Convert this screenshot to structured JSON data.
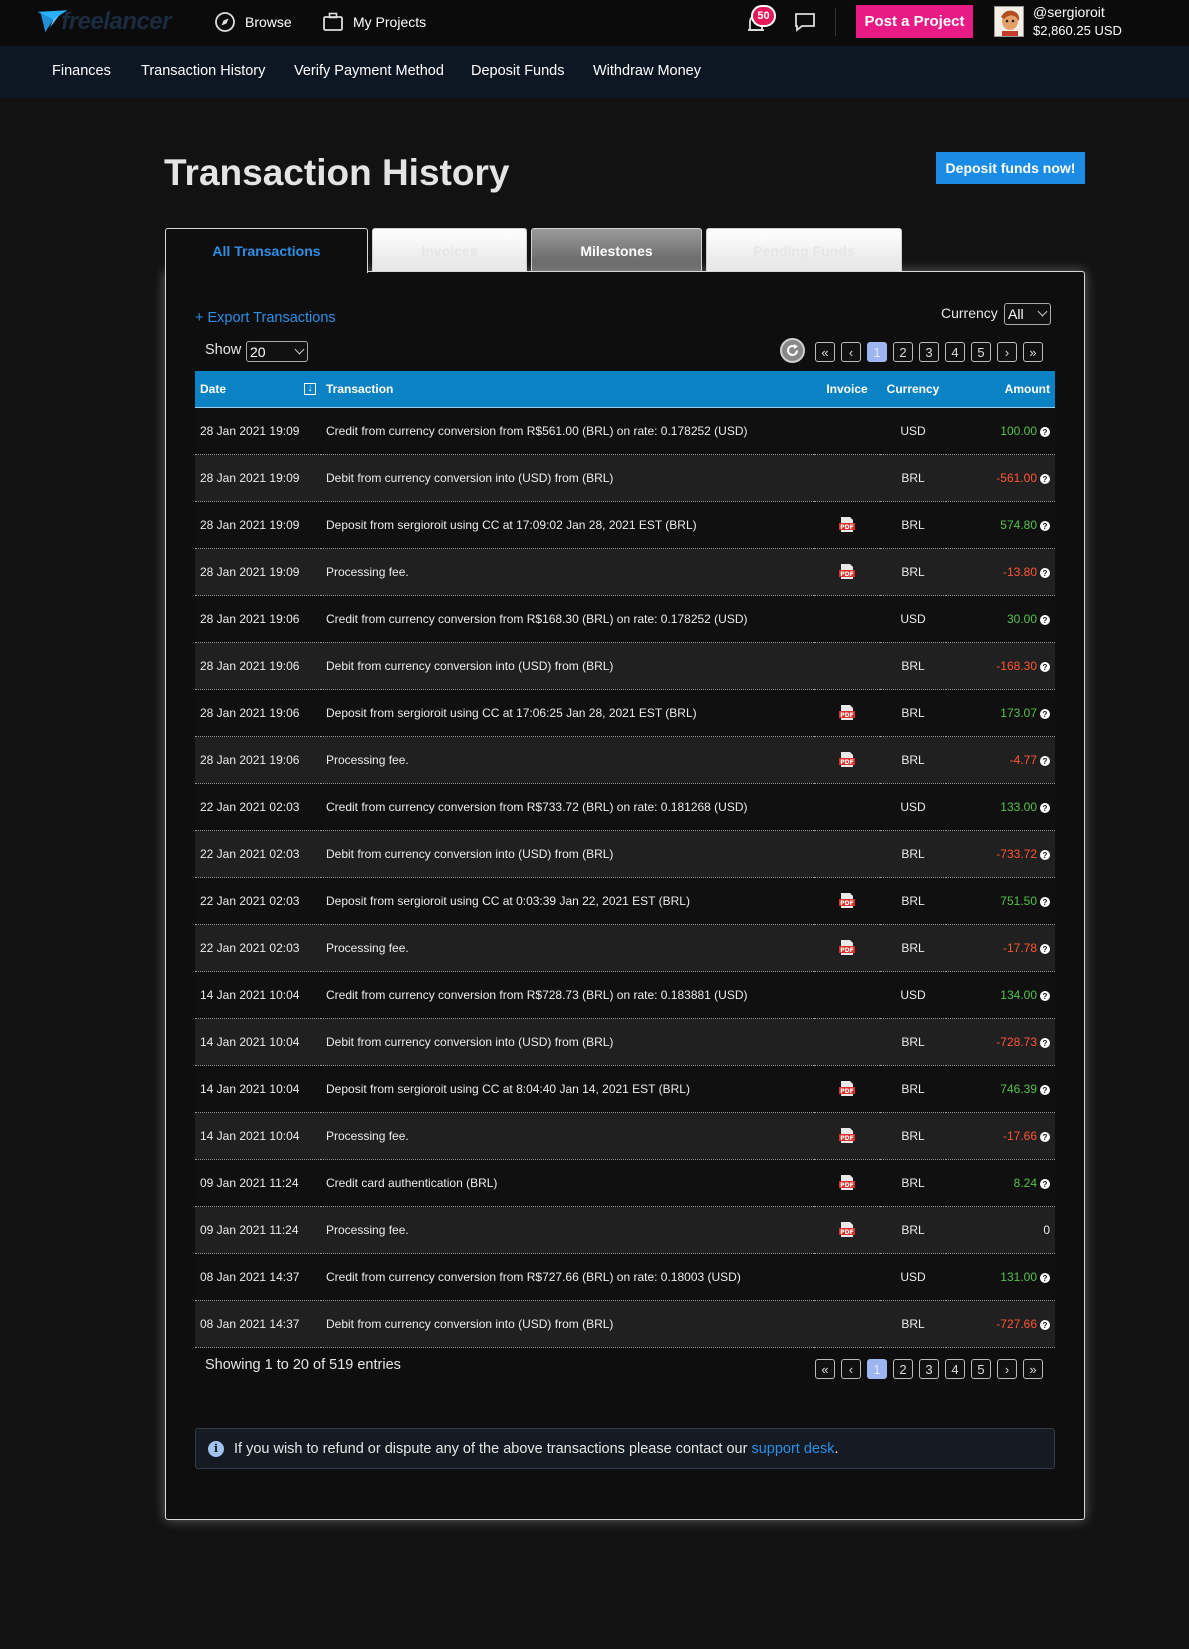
{
  "topbar": {
    "logo_text": "freelancer",
    "browse": "Browse",
    "my_projects": "My Projects",
    "notif_count": "50",
    "post_project": "Post a Project",
    "username": "@sergioroit",
    "balance": "$2,860.25 USD"
  },
  "subnav": [
    "Finances",
    "Transaction History",
    "Verify Payment Method",
    "Deposit Funds",
    "Withdraw Money"
  ],
  "page": {
    "title": "Transaction History",
    "deposit_button": "Deposit funds now!"
  },
  "tabs": [
    "All Transactions",
    "Invoices",
    "Milestones",
    "Pending Funds"
  ],
  "controls": {
    "export": "+ Export Transactions",
    "currency_label": "Currency",
    "currency_value": "All",
    "show_label": "Show",
    "show_value": "20"
  },
  "pagination": {
    "first": "«",
    "prev": "‹",
    "next": "›",
    "last": "»",
    "pages": [
      "1",
      "2",
      "3",
      "4",
      "5"
    ],
    "active": "1"
  },
  "table": {
    "headers": [
      "Date",
      "Transaction",
      "Invoice",
      "Currency",
      "Amount"
    ],
    "rows": [
      {
        "date": "28 Jan 2021 19:09",
        "desc": "Credit from currency conversion from R$561.00 (BRL) on rate: 0.178252 (USD)",
        "pdf": false,
        "currency": "USD",
        "amount": "100.00",
        "sign": "pos"
      },
      {
        "date": "28 Jan 2021 19:09",
        "desc": "Debit from currency conversion into (USD) from (BRL)",
        "pdf": false,
        "currency": "BRL",
        "amount": "-561.00",
        "sign": "neg"
      },
      {
        "date": "28 Jan 2021 19:09",
        "desc": "Deposit from sergioroit using CC at 17:09:02 Jan 28, 2021 EST (BRL)",
        "pdf": true,
        "currency": "BRL",
        "amount": "574.80",
        "sign": "pos"
      },
      {
        "date": "28 Jan 2021 19:09",
        "desc": "Processing fee.",
        "pdf": true,
        "currency": "BRL",
        "amount": "-13.80",
        "sign": "neg"
      },
      {
        "date": "28 Jan 2021 19:06",
        "desc": "Credit from currency conversion from R$168.30 (BRL) on rate: 0.178252 (USD)",
        "pdf": false,
        "currency": "USD",
        "amount": "30.00",
        "sign": "pos"
      },
      {
        "date": "28 Jan 2021 19:06",
        "desc": "Debit from currency conversion into (USD) from (BRL)",
        "pdf": false,
        "currency": "BRL",
        "amount": "-168.30",
        "sign": "neg"
      },
      {
        "date": "28 Jan 2021 19:06",
        "desc": "Deposit from sergioroit using CC at 17:06:25 Jan 28, 2021 EST (BRL)",
        "pdf": true,
        "currency": "BRL",
        "amount": "173.07",
        "sign": "pos"
      },
      {
        "date": "28 Jan 2021 19:06",
        "desc": "Processing fee.",
        "pdf": true,
        "currency": "BRL",
        "amount": "-4.77",
        "sign": "neg"
      },
      {
        "date": "22 Jan 2021 02:03",
        "desc": "Credit from currency conversion from R$733.72 (BRL) on rate: 0.181268 (USD)",
        "pdf": false,
        "currency": "USD",
        "amount": "133.00",
        "sign": "pos"
      },
      {
        "date": "22 Jan 2021 02:03",
        "desc": "Debit from currency conversion into (USD) from (BRL)",
        "pdf": false,
        "currency": "BRL",
        "amount": "-733.72",
        "sign": "neg"
      },
      {
        "date": "22 Jan 2021 02:03",
        "desc": "Deposit from sergioroit using CC at 0:03:39 Jan 22, 2021 EST (BRL)",
        "pdf": true,
        "currency": "BRL",
        "amount": "751.50",
        "sign": "pos"
      },
      {
        "date": "22 Jan 2021 02:03",
        "desc": "Processing fee.",
        "pdf": true,
        "currency": "BRL",
        "amount": "-17.78",
        "sign": "neg"
      },
      {
        "date": "14 Jan 2021 10:04",
        "desc": "Credit from currency conversion from R$728.73 (BRL) on rate: 0.183881 (USD)",
        "pdf": false,
        "currency": "USD",
        "amount": "134.00",
        "sign": "pos"
      },
      {
        "date": "14 Jan 2021 10:04",
        "desc": "Debit from currency conversion into (USD) from (BRL)",
        "pdf": false,
        "currency": "BRL",
        "amount": "-728.73",
        "sign": "neg"
      },
      {
        "date": "14 Jan 2021 10:04",
        "desc": "Deposit from sergioroit using CC at 8:04:40 Jan 14, 2021 EST (BRL)",
        "pdf": true,
        "currency": "BRL",
        "amount": "746.39",
        "sign": "pos"
      },
      {
        "date": "14 Jan 2021 10:04",
        "desc": "Processing fee.",
        "pdf": true,
        "currency": "BRL",
        "amount": "-17.66",
        "sign": "neg"
      },
      {
        "date": "09 Jan 2021 11:24",
        "desc": "Credit card authentication (BRL)",
        "pdf": true,
        "currency": "BRL",
        "amount": "8.24",
        "sign": "pos"
      },
      {
        "date": "09 Jan 2021 11:24",
        "desc": "Processing fee.",
        "pdf": true,
        "currency": "BRL",
        "amount": "0",
        "sign": "zero"
      },
      {
        "date": "08 Jan 2021 14:37",
        "desc": "Credit from currency conversion from R$727.66 (BRL) on rate: 0.18003 (USD)",
        "pdf": false,
        "currency": "USD",
        "amount": "131.00",
        "sign": "pos"
      },
      {
        "date": "08 Jan 2021 14:37",
        "desc": "Debit from currency conversion into (USD) from (BRL)",
        "pdf": false,
        "currency": "BRL",
        "amount": "-727.66",
        "sign": "neg"
      }
    ]
  },
  "footer": {
    "showing": "Showing 1 to 20 of 519 entries",
    "notice_text": "If you wish to refund or dispute any of the above transactions please contact our",
    "notice_link": "support desk",
    "notice_end": "."
  },
  "colors": {
    "accent": "#1a8ce6",
    "post_button": "#e81a84",
    "positive": "#54c24a",
    "negative": "#ff5533",
    "table_header": "#0b82c4"
  }
}
